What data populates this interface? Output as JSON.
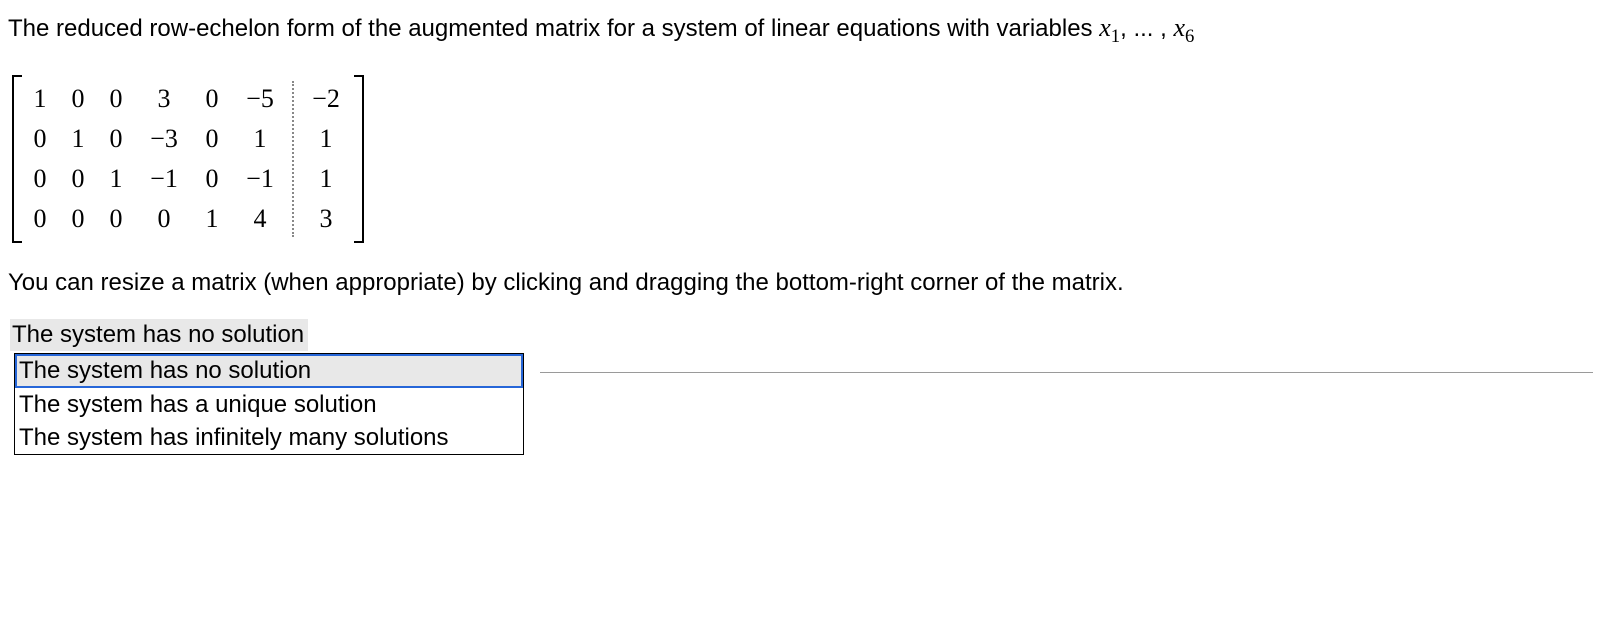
{
  "intro": {
    "prefix": "The reduced row-echelon form of the augmented matrix for a system of linear equations with variables ",
    "var_letter": "x",
    "first_sub": "1",
    "middle": ", ... , ",
    "last_sub": "6"
  },
  "matrix": {
    "rows": 4,
    "left_cols": 6,
    "left": [
      [
        "1",
        "0",
        "0",
        "3",
        "0",
        "−5"
      ],
      [
        "0",
        "1",
        "0",
        "−3",
        "0",
        "1"
      ],
      [
        "0",
        "0",
        "1",
        "−1",
        "0",
        "−1"
      ],
      [
        "0",
        "0",
        "0",
        "0",
        "1",
        "4"
      ]
    ],
    "right": [
      [
        "−2"
      ],
      [
        "1"
      ],
      [
        "1"
      ],
      [
        "3"
      ]
    ]
  },
  "resize_note": "You can resize a matrix (when appropriate) by clicking and dragging the bottom-right corner of the matrix.",
  "select": {
    "current": "The system has no solution",
    "options": [
      "The system has no solution",
      "The system has a unique solution",
      "The system has infinitely many solutions"
    ],
    "selected_index": 0
  }
}
